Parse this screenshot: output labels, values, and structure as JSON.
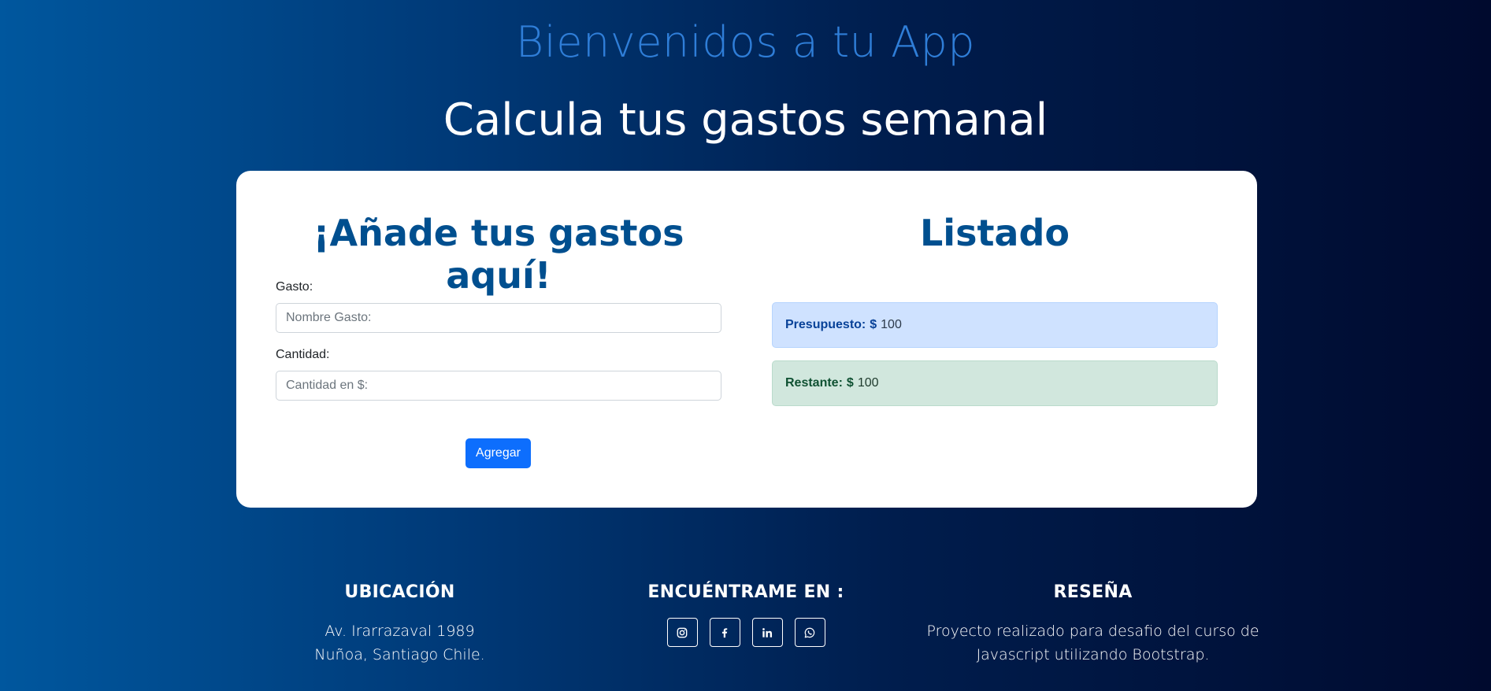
{
  "header": {
    "welcome": "Bienvenidos a tu App",
    "subtitle": "Calcula tus gastos semanal"
  },
  "form": {
    "title": "¡Añade tus gastos aquí!",
    "expense_label": "Gasto:",
    "expense_placeholder": "Nombre Gasto:",
    "expense_value": "",
    "amount_label": "Cantidad:",
    "amount_placeholder": "Cantidad en $:",
    "amount_value": "",
    "submit_label": "Agregar"
  },
  "list": {
    "title": "Listado",
    "budget_label": "Presupuesto:",
    "budget_currency": "$",
    "budget_value": "100",
    "remaining_label": "Restante:",
    "remaining_currency": "$",
    "remaining_value": "100"
  },
  "footer": {
    "location_title": "UBICACIÓN",
    "location_line1": "Av. Irarrazaval 1989",
    "location_line2": "Nuñoa, Santiago Chile.",
    "social_title": "ENCUÉNTRAME EN :",
    "social_icons": [
      "instagram-icon",
      "facebook-icon",
      "linkedin-icon",
      "whatsapp-icon"
    ],
    "review_title": "RESEÑA",
    "review_line1": "Proyecto realizado para desafio del curso de",
    "review_line2": "Javascript utilizando Bootstrap."
  },
  "colors": {
    "primary_button": "#0d6efd",
    "heading_blue": "#004f8f",
    "welcome_blue": "#2f7ed8",
    "budget_alert_bg": "#cfe2ff",
    "remaining_alert_bg": "#d1e7dd"
  }
}
